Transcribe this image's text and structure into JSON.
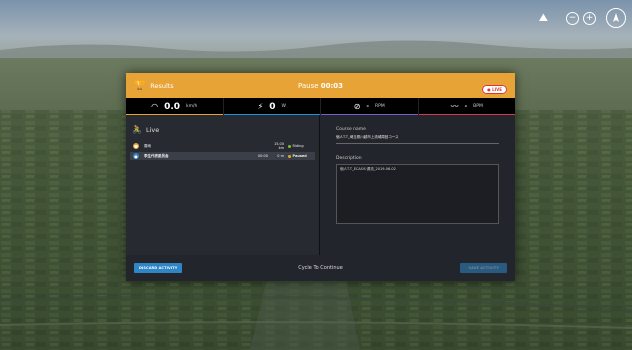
{
  "header": {
    "title": "Results",
    "pause_label": "Pause",
    "pause_time": "00:03",
    "badge": "● LIVE"
  },
  "metrics": [
    {
      "icon": "speedometer-icon",
      "value": "0.0",
      "unit": "km/h",
      "color": "#e8a336"
    },
    {
      "icon": "lightning-icon",
      "value": "0",
      "unit": "W",
      "color": "#1e90d6"
    },
    {
      "icon": "cadence-icon",
      "value": "-",
      "unit": "RPM",
      "color": "#7a5cc7"
    },
    {
      "icon": "heartbeat-icon",
      "value": "-",
      "unit": "BPM",
      "color": "#d63b4a"
    }
  ],
  "live": {
    "title": "Live",
    "riders": [
      {
        "name": "雲雨",
        "time": "",
        "dist": "15.00 km",
        "status": "Riding",
        "status_color": "#7dbf3a",
        "avatar_color": "#e8a336",
        "avatar_glyph": "☻"
      },
      {
        "name": "李生代表委员会",
        "time": "00:00",
        "dist": "0 m",
        "status": "Paused",
        "status_color": "#e8a336",
        "avatar_color": "#2f86c7",
        "avatar_glyph": "●"
      }
    ]
  },
  "course": {
    "name_label": "Course name",
    "name_value": "個人T.T_埼玉県川越市上流域周回コース",
    "desc_label": "Description",
    "desc_value": "個人T.T_ECAOS·源流_2019-06-02"
  },
  "footer": {
    "discard_label": "DISCARD ACTIVITY",
    "cycle_label": "Cycle To Continue",
    "save_label": "SAVE ACTIVITY"
  }
}
